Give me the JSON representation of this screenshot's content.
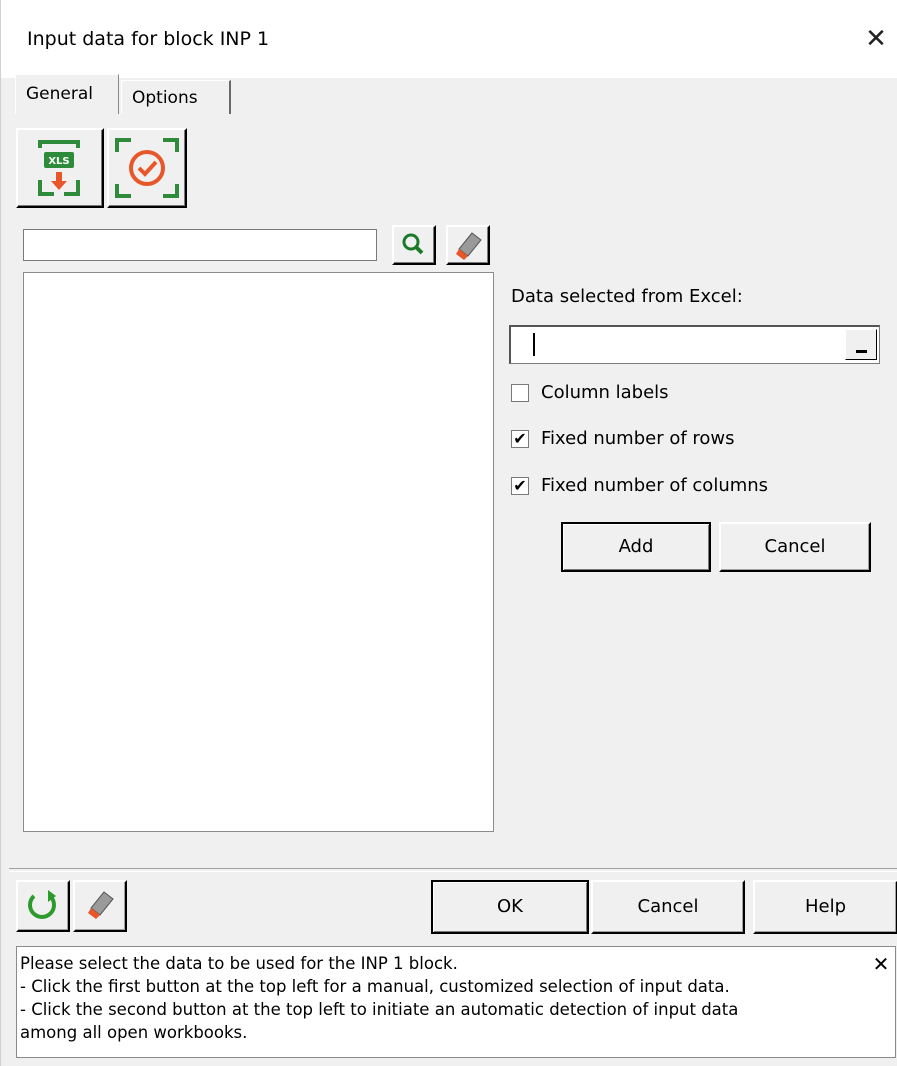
{
  "window": {
    "title": "Input data for block INP 1",
    "close_symbol": "✕"
  },
  "tabs": [
    {
      "label": "General",
      "selected": true
    },
    {
      "label": "Options",
      "selected": false
    }
  ],
  "toolbar": {
    "import_icon": "xls-import-icon",
    "detect_icon": "auto-detect-icon",
    "import_badge": "XLS"
  },
  "search": {
    "value": ""
  },
  "data_selection": {
    "label": "Data selected from Excel:",
    "value": "",
    "range_button": "_"
  },
  "options": [
    {
      "label": "Column labels",
      "checked": false
    },
    {
      "label": "Fixed number of rows",
      "checked": true
    },
    {
      "label": "Fixed number of columns",
      "checked": true
    }
  ],
  "check_mark": "✔",
  "buttons": {
    "add": "Add",
    "cancel_add": "Cancel",
    "ok": "OK",
    "cancel": "Cancel",
    "help": "Help"
  },
  "info": {
    "lines": [
      "Please select the data to be used for the INP 1 block.",
      "- Click the first button at the top left for a manual, customized selection of input data.",
      "- Click the second button at the top left to initiate an automatic detection of input data",
      "among all open workbooks."
    ],
    "close_symbol": "✕"
  },
  "colors": {
    "accent_green": "#2e8b3a",
    "icon_orange": "#e8572a",
    "dialog_bg": "#f0f0f0"
  }
}
